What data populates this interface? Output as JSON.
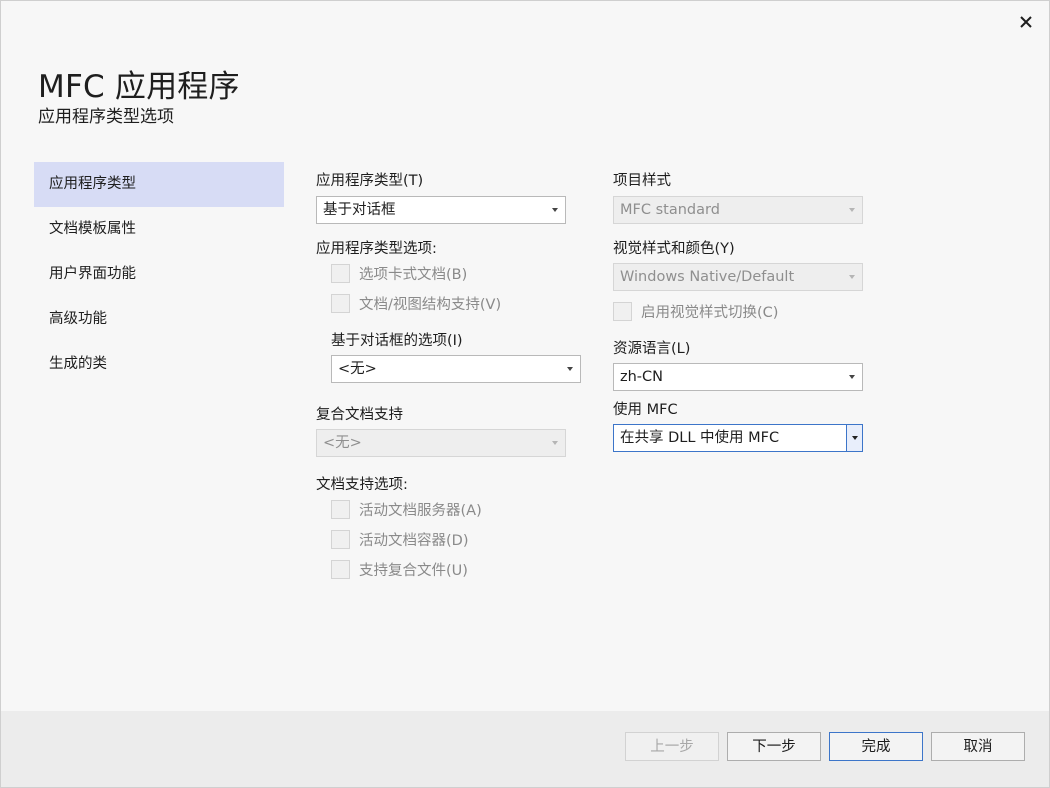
{
  "window": {
    "title": "MFC 应用程序",
    "subtitle": "应用程序类型选项",
    "close_icon": "close-icon"
  },
  "sidebar": {
    "items": [
      {
        "label": "应用程序类型",
        "active": true
      },
      {
        "label": "文档模板属性"
      },
      {
        "label": "用户界面功能"
      },
      {
        "label": "高级功能"
      },
      {
        "label": "生成的类"
      }
    ]
  },
  "left": {
    "app_type_label": "应用程序类型(T)",
    "app_type_value": "基于对话框",
    "app_type_options_label": "应用程序类型选项:",
    "tabbed_docs": "选项卡式文档(B)",
    "doc_view_support": "文档/视图结构支持(V)",
    "dialog_options_label": "基于对话框的选项(I)",
    "dialog_options_value": "<无>",
    "compound_doc_label": "复合文档支持",
    "compound_doc_value": "<无>",
    "doc_support_options_label": "文档支持选项:",
    "active_doc_server": "活动文档服务器(A)",
    "active_doc_container": "活动文档容器(D)",
    "compound_file_support": "支持复合文件(U)"
  },
  "right": {
    "project_style_label": "项目样式",
    "project_style_value": "MFC standard",
    "visual_style_label": "视觉样式和颜色(Y)",
    "visual_style_value": "Windows Native/Default",
    "enable_style_switch": "启用视觉样式切换(C)",
    "resource_lang_label": "资源语言(L)",
    "resource_lang_value": "zh-CN",
    "use_mfc_label": "使用 MFC",
    "use_mfc_value": "在共享 DLL 中使用 MFC"
  },
  "footer": {
    "prev": "上一步",
    "next": "下一步",
    "finish": "完成",
    "cancel": "取消"
  }
}
